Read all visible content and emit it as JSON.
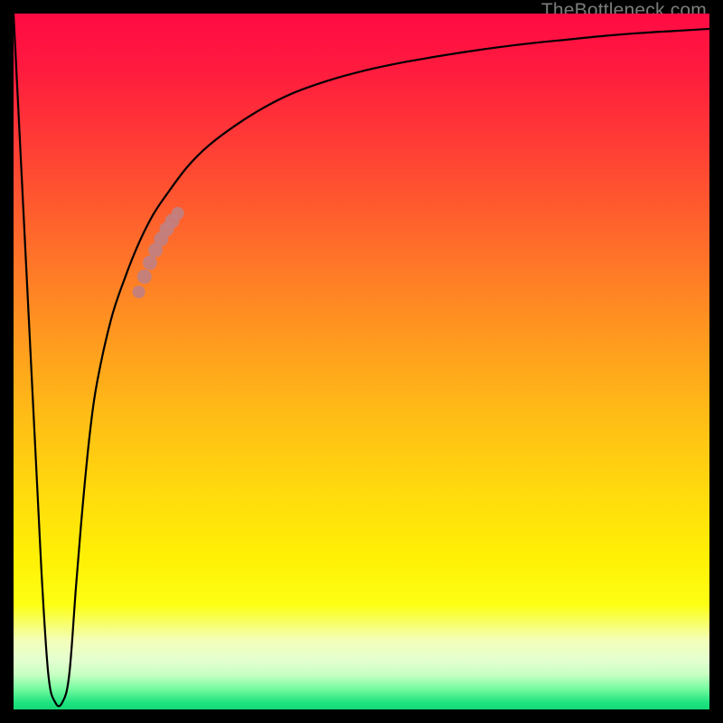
{
  "watermark": "TheBottleneck.com",
  "colors": {
    "curve_stroke": "#000000",
    "marker_fill": "#c18081",
    "marker_stroke": "#c18081"
  },
  "chart_data": {
    "type": "line",
    "title": "",
    "xlabel": "",
    "ylabel": "",
    "xlim": [
      0,
      100
    ],
    "ylim": [
      0,
      100
    ],
    "series": [
      {
        "name": "bottleneck-curve",
        "x": [
          0,
          1,
          2,
          3,
          4,
          5,
          6,
          7,
          8,
          9,
          10,
          11,
          12,
          14,
          16,
          18,
          20,
          22,
          25,
          28,
          32,
          36,
          40,
          45,
          50,
          55,
          60,
          65,
          70,
          75,
          80,
          85,
          90,
          95,
          100
        ],
        "y": [
          100,
          80,
          60,
          40,
          20,
          5,
          1,
          1,
          5,
          18,
          30,
          40,
          47,
          56,
          62,
          67,
          71,
          74,
          78,
          81,
          84,
          86.5,
          88.5,
          90.3,
          91.7,
          92.8,
          93.7,
          94.5,
          95.2,
          95.8,
          96.3,
          96.8,
          97.2,
          97.5,
          97.8
        ]
      }
    ],
    "markers": {
      "name": "highlight-segment",
      "x": [
        18.0,
        18.8,
        19.6,
        20.4,
        21.2,
        22.0,
        22.8,
        23.6
      ],
      "y": [
        60.0,
        62.2,
        64.2,
        66.0,
        67.6,
        69.0,
        70.2,
        71.3
      ]
    }
  }
}
